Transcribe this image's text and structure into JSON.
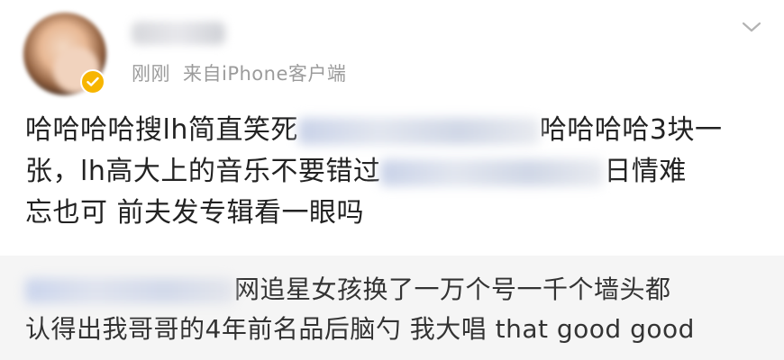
{
  "post": {
    "author_avatar": "avatar",
    "verified_badge_icon": "verified-check-icon",
    "timestamp": "刚刚",
    "source": "来自iPhone客户端",
    "menu_icon": "chevron-down-icon",
    "lines": [
      {
        "a": "哈哈哈哈搜lh简直笑死",
        "b": "哈哈哈哈3块一"
      },
      {
        "a": "张，lh高大上的音乐不要错过",
        "b": "日情难"
      },
      {
        "a": "忘也可 前夫发专辑看一眼吗",
        "b": ""
      }
    ]
  },
  "quote": {
    "lines": [
      {
        "a": "",
        "b": "网追星女孩换了一万个号一千个墙头都"
      },
      {
        "a": "认得出我哥哥的4年前名品后脑勺 我大唱 that good good",
        "b": ""
      }
    ]
  },
  "colors": {
    "body_text": "#222222",
    "meta_text": "#9b9b9b",
    "quote_bg": "#f5f5f5",
    "badge": "#f7b500"
  }
}
